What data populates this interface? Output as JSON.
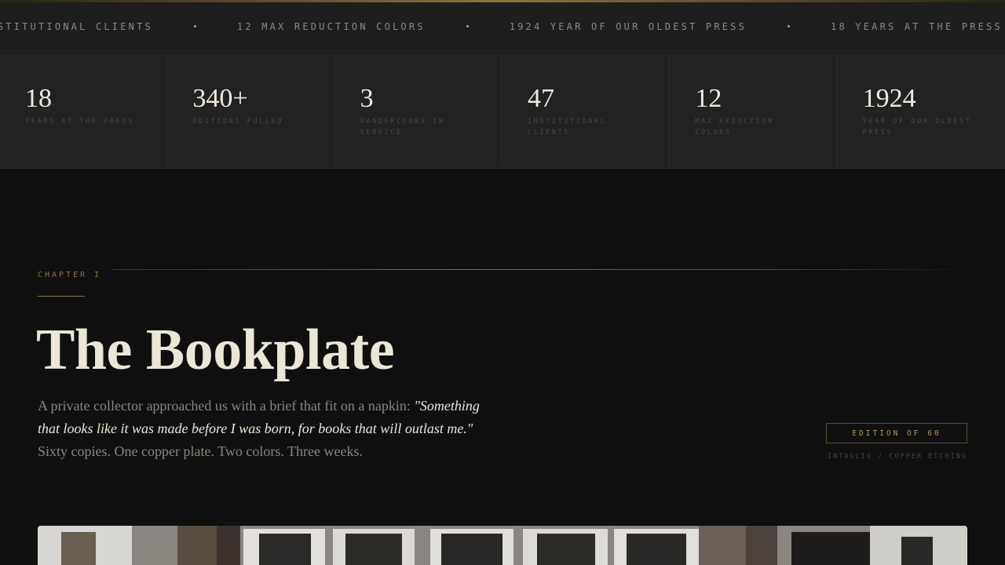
{
  "ticker": {
    "items": [
      "INSTITUTIONAL CLIENTS",
      "12 MAX REDUCTION COLORS",
      "1924 YEAR OF OUR OLDEST PRESS",
      "18 YEARS AT THE PRESS"
    ]
  },
  "stats": [
    {
      "value": "18",
      "label": "YEARS AT THE PRESS"
    },
    {
      "value": "340+",
      "label": "EDITIONS PULLED"
    },
    {
      "value": "3",
      "label": "VANDERCOOKS IN SERVICE"
    },
    {
      "value": "47",
      "label": "INSTITUTIONAL CLIENTS"
    },
    {
      "value": "12",
      "label": "MAX REDUCTION COLORS"
    },
    {
      "value": "1924",
      "label": "YEAR OF OUR OLDEST PRESS"
    }
  ],
  "chapter": {
    "label": "CHAPTER I",
    "title": "The Bookplate",
    "lede_intro": "A private collector approached us with a brief that fit on a napkin: ",
    "lede_quote": "\"Something that looks like it was made before I was born, for books that will outlast me.\"",
    "lede_outro": " Sixty copies. One copper plate. Two colors. Three weeks.",
    "edition_badge": "EDITION OF 60",
    "edition_sub": "INTAGLIO / COPPER ETCHING"
  },
  "colors": {
    "accent_gold": "#c9a24a",
    "background": "#0f0f0f",
    "stats_panel": "#222222",
    "title_text": "#ece6d8"
  }
}
